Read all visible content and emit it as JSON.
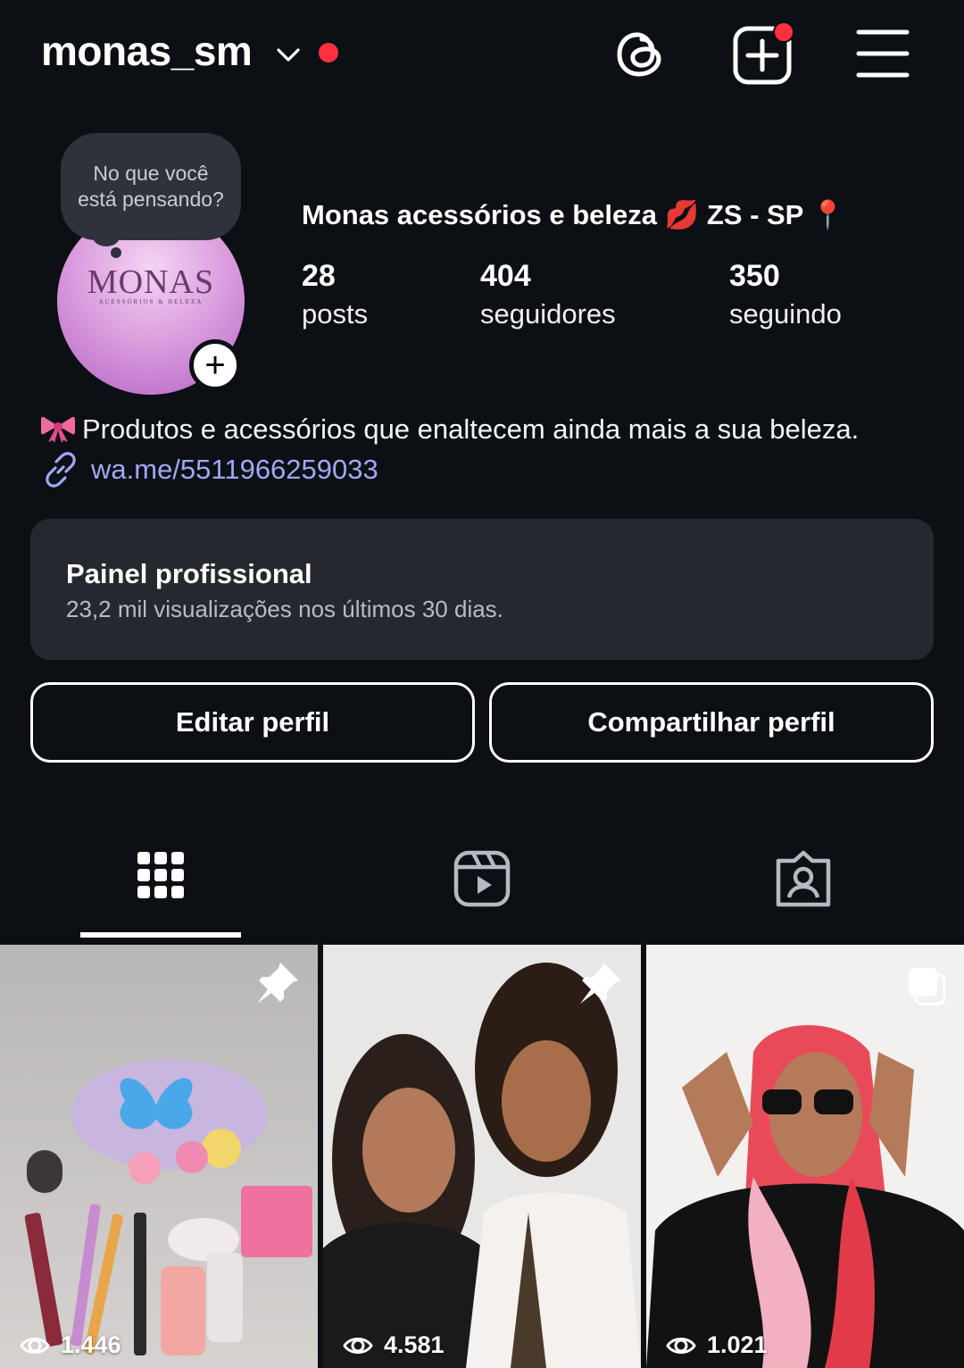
{
  "header": {
    "username": "monas_sm",
    "accent_red": "#ff3040",
    "icons": [
      "chevron-down-icon",
      "threads-icon",
      "create-icon",
      "menu-icon"
    ]
  },
  "note": {
    "text": "No que você está pensando?"
  },
  "profile": {
    "display_name": "Monas acessórios e beleza 💋 ZS - SP 📍",
    "avatar_logo": "MONAS",
    "avatar_logo_sub": "ACESSÓRIOS & BELEZA",
    "stats": [
      {
        "value": "28",
        "label": "posts"
      },
      {
        "value": "404",
        "label": "seguidores"
      },
      {
        "value": "350",
        "label": "seguindo"
      }
    ],
    "bio": "Produtos e acessórios que enaltecem ainda mais a sua beleza.",
    "link": "wa.me/5511966259033",
    "link_color": "#a0a8f5"
  },
  "dashboard": {
    "title": "Painel profissional",
    "subtitle": "23,2 mil visualizações nos últimos 30 dias."
  },
  "buttons": {
    "edit": "Editar perfil",
    "share": "Compartilhar perfil"
  },
  "tabs": [
    "grid-tab",
    "reels-tab",
    "tagged-tab"
  ],
  "posts": [
    {
      "views": "1.446",
      "badge": "pin-icon"
    },
    {
      "views": "4.581",
      "badge": "pin-icon"
    },
    {
      "views": "1.021",
      "badge": "multiple-photos-icon"
    }
  ]
}
